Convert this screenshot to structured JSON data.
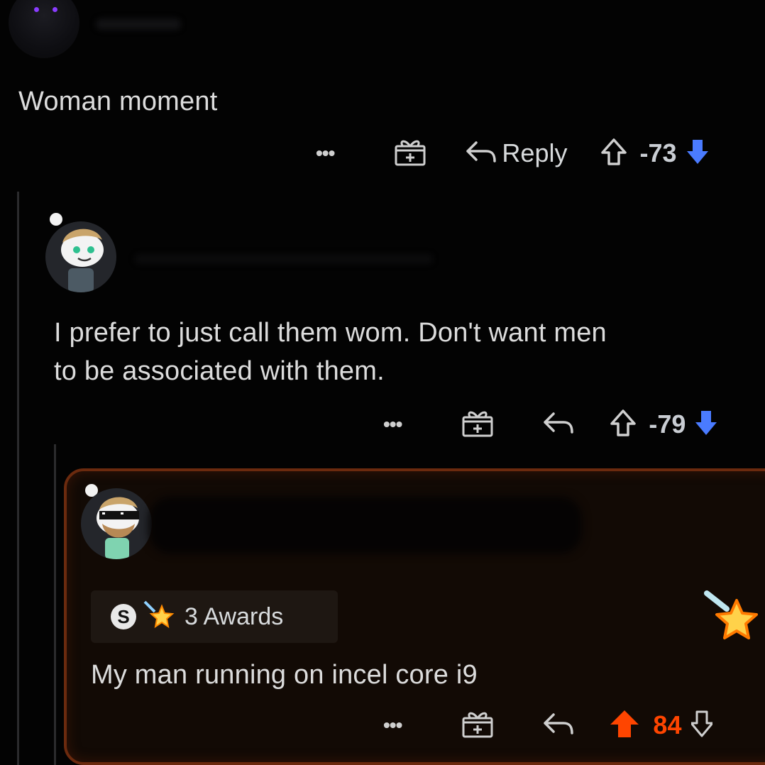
{
  "comments": [
    {
      "text": "Woman moment",
      "actions": {
        "more": "•••",
        "reply_label": "Reply",
        "score": "-73"
      }
    },
    {
      "text_line1": "I prefer to just call them wom. Don't want men",
      "text_line2": "to be associated with them.",
      "actions": {
        "more": "•••",
        "score": "-79"
      }
    },
    {
      "awards_label": "3 Awards",
      "award_badge": "S",
      "text": "My man running on incel core i9",
      "actions": {
        "more": "•••",
        "score": "84"
      }
    }
  ],
  "colors": {
    "background": "#030303",
    "upvote_active": "#ff4500",
    "downvote_accent": "#4a7bff",
    "highlight_border": "#6b2a0e"
  },
  "icons": [
    "gift-icon",
    "reply-icon",
    "upvote-icon",
    "downvote-icon",
    "more-icon",
    "award-icon",
    "star-award-icon"
  ]
}
